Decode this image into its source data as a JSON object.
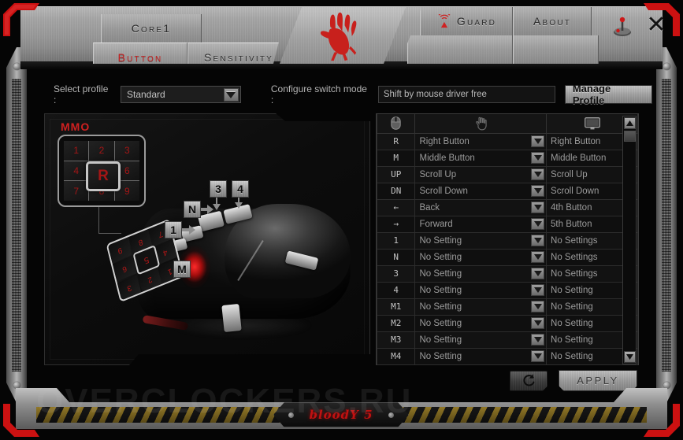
{
  "window": {
    "title": "Bloody 5",
    "close_label": "✕",
    "joystick_icon": "joystick-icon",
    "accent_red": "#c71f1f",
    "metal_light": "#bdbdbd"
  },
  "header": {
    "tabs_row1": [
      {
        "label": "Core1",
        "name": "tab-core1",
        "active": false
      }
    ],
    "tabs_row2": [
      {
        "label": "Button",
        "name": "tab-button",
        "active": true
      },
      {
        "label": "Sensitivity",
        "name": "tab-sensitivity",
        "active": false
      }
    ],
    "tabs_right": [
      {
        "label": "Guard",
        "name": "tab-guard",
        "icon": "signal-icon",
        "active": false
      },
      {
        "label": "About",
        "name": "tab-about",
        "active": false
      }
    ],
    "logo_icon": "bloody-handprint-icon"
  },
  "toolbar": {
    "select_profile_label": "Select profile :",
    "profile_value": "Standard",
    "profile_placeholder": "Standard",
    "switch_mode_label": "Configure switch mode :",
    "switch_mode_value": "Shift by mouse driver free",
    "manage_profile_label": "Manage Profile"
  },
  "mouse_panel": {
    "mmo_label": "MMO",
    "keypad": [
      "1",
      "2",
      "3",
      "4",
      "6",
      "7",
      "8",
      "9"
    ],
    "keypad_center": "R",
    "thumb_pad": [
      "9",
      "8",
      "7",
      "6",
      "4",
      "3",
      "2",
      "1"
    ],
    "thumb_center": "5",
    "callouts": [
      {
        "label": "3",
        "name": "callout-3"
      },
      {
        "label": "4",
        "name": "callout-4"
      },
      {
        "label": "N",
        "name": "callout-n"
      },
      {
        "label": "1",
        "name": "callout-1"
      },
      {
        "label": "M",
        "name": "callout-m"
      }
    ]
  },
  "table": {
    "headers": [
      {
        "icon": "mouse-icon",
        "name": "col-header-mouse"
      },
      {
        "icon": "hand-cursor-icon",
        "name": "col-header-hand"
      },
      {
        "icon": "monitor-icon",
        "name": "col-header-monitor"
      }
    ],
    "rows": [
      {
        "key": "R",
        "assigned": "Right Button",
        "default": "Right Button"
      },
      {
        "key": "M",
        "assigned": "Middle Button",
        "default": "Middle Button"
      },
      {
        "key": "UP",
        "assigned": "Scroll Up",
        "default": "Scroll Up"
      },
      {
        "key": "DN",
        "assigned": "Scroll Down",
        "default": "Scroll Down"
      },
      {
        "key": "←",
        "assigned": "Back",
        "default": "4th Button"
      },
      {
        "key": "→",
        "assigned": "Forward",
        "default": "5th Button"
      },
      {
        "key": "1",
        "assigned": "No Setting",
        "default": "No Settings"
      },
      {
        "key": "N",
        "assigned": "No Setting",
        "default": "No Settings"
      },
      {
        "key": "3",
        "assigned": "No Setting",
        "default": "No Settings"
      },
      {
        "key": "4",
        "assigned": "No Setting",
        "default": "No Setting"
      },
      {
        "key": "M1",
        "assigned": "No Setting",
        "default": "No Setting"
      },
      {
        "key": "M2",
        "assigned": "No Setting",
        "default": "No Setting"
      },
      {
        "key": "M3",
        "assigned": "No Setting",
        "default": "No Setting"
      },
      {
        "key": "M4",
        "assigned": "No Setting",
        "default": "No Setting"
      }
    ]
  },
  "actions": {
    "reset_icon": "reset-icon",
    "apply_label": "APPLY"
  },
  "footer": {
    "brand": "bloodY 5",
    "watermark": "OVERCLOCKERS.RU"
  }
}
